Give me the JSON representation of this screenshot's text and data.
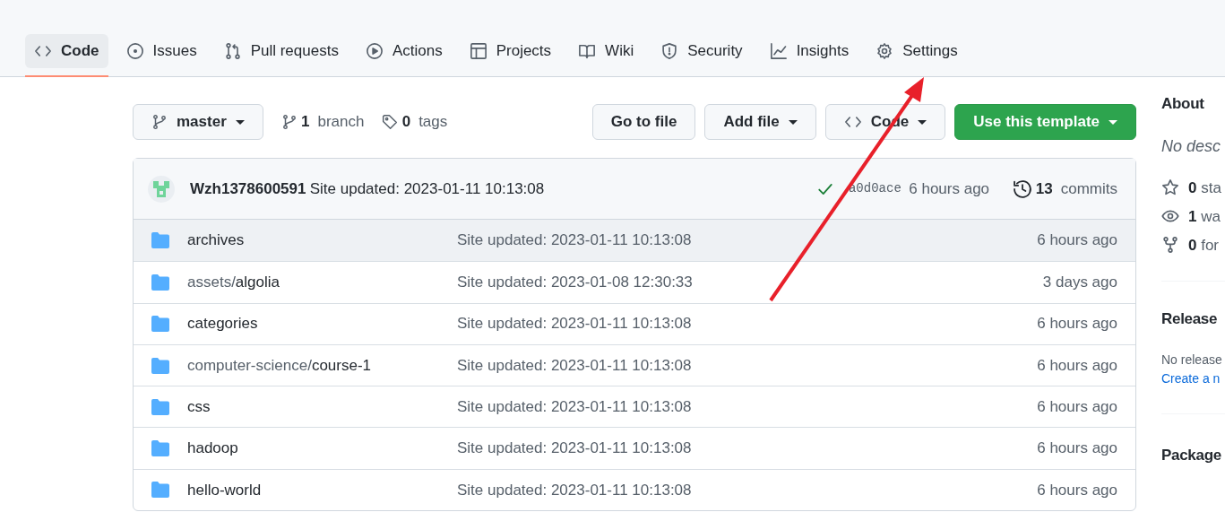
{
  "tabs": [
    {
      "label": "Code",
      "selected": true
    },
    {
      "label": "Issues",
      "selected": false
    },
    {
      "label": "Pull requests",
      "selected": false
    },
    {
      "label": "Actions",
      "selected": false
    },
    {
      "label": "Projects",
      "selected": false
    },
    {
      "label": "Wiki",
      "selected": false
    },
    {
      "label": "Security",
      "selected": false
    },
    {
      "label": "Insights",
      "selected": false
    },
    {
      "label": "Settings",
      "selected": false
    }
  ],
  "branch_button": {
    "label": "master"
  },
  "branches": {
    "count": "1",
    "label": "branch"
  },
  "tags": {
    "count": "0",
    "label": "tags"
  },
  "actions": [
    {
      "label": "Go to file",
      "kind": "plain"
    },
    {
      "label": "Add file",
      "kind": "dropdown"
    },
    {
      "label": "Code",
      "kind": "code"
    },
    {
      "label": "Use this template",
      "kind": "primary"
    }
  ],
  "latest_commit": {
    "author": "Wzh1378600591",
    "message": "Site updated: 2023-01-11 10:13:08",
    "sha": "a0d0ace",
    "time": "6 hours ago",
    "commit_count": "13",
    "commit_label": "commits"
  },
  "files": [
    {
      "name": "archives",
      "message": "Site updated: 2023-01-11 10:13:08",
      "time": "6 hours ago",
      "highlighted": true
    },
    {
      "path": "assets/",
      "name": "algolia",
      "message": "Site updated: 2023-01-08 12:30:33",
      "time": "3 days ago",
      "highlighted": false
    },
    {
      "name": "categories",
      "message": "Site updated: 2023-01-11 10:13:08",
      "time": "6 hours ago",
      "highlighted": false
    },
    {
      "path": "computer-science/",
      "name": "course-1",
      "message": "Site updated: 2023-01-11 10:13:08",
      "time": "6 hours ago",
      "highlighted": false
    },
    {
      "name": "css",
      "message": "Site updated: 2023-01-11 10:13:08",
      "time": "6 hours ago",
      "highlighted": false
    },
    {
      "name": "hadoop",
      "message": "Site updated: 2023-01-11 10:13:08",
      "time": "6 hours ago",
      "highlighted": false
    },
    {
      "name": "hello-world",
      "message": "Site updated: 2023-01-11 10:13:08",
      "time": "6 hours ago",
      "highlighted": false
    }
  ],
  "sidebar": {
    "about_title": "About",
    "description": "No desc",
    "stats": [
      {
        "count": "0",
        "label": "sta"
      },
      {
        "count": "1",
        "label": "wa"
      },
      {
        "count": "0",
        "label": "for"
      }
    ],
    "releases_title": "Release",
    "releases_text": "No release",
    "releases_link": "Create a n",
    "packages_title": "Package"
  }
}
